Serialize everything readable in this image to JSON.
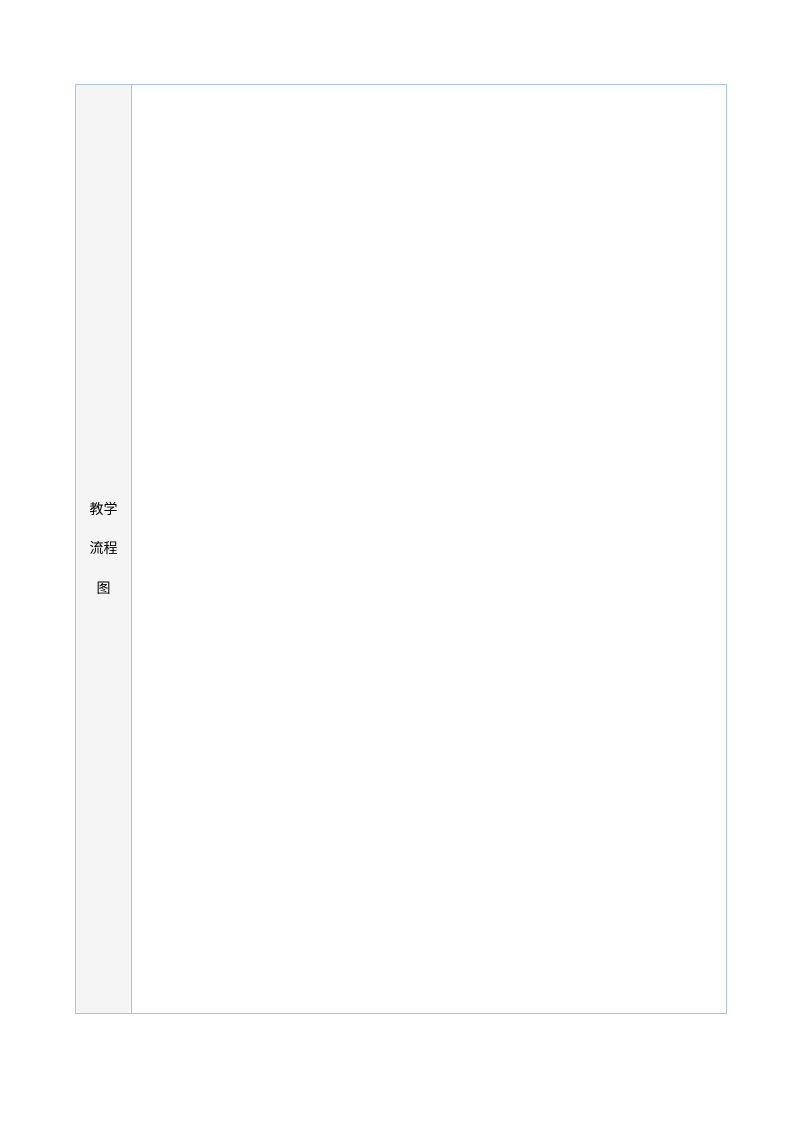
{
  "sidebar": {
    "line1": "教学",
    "line2": "流程",
    "line3": "图"
  }
}
